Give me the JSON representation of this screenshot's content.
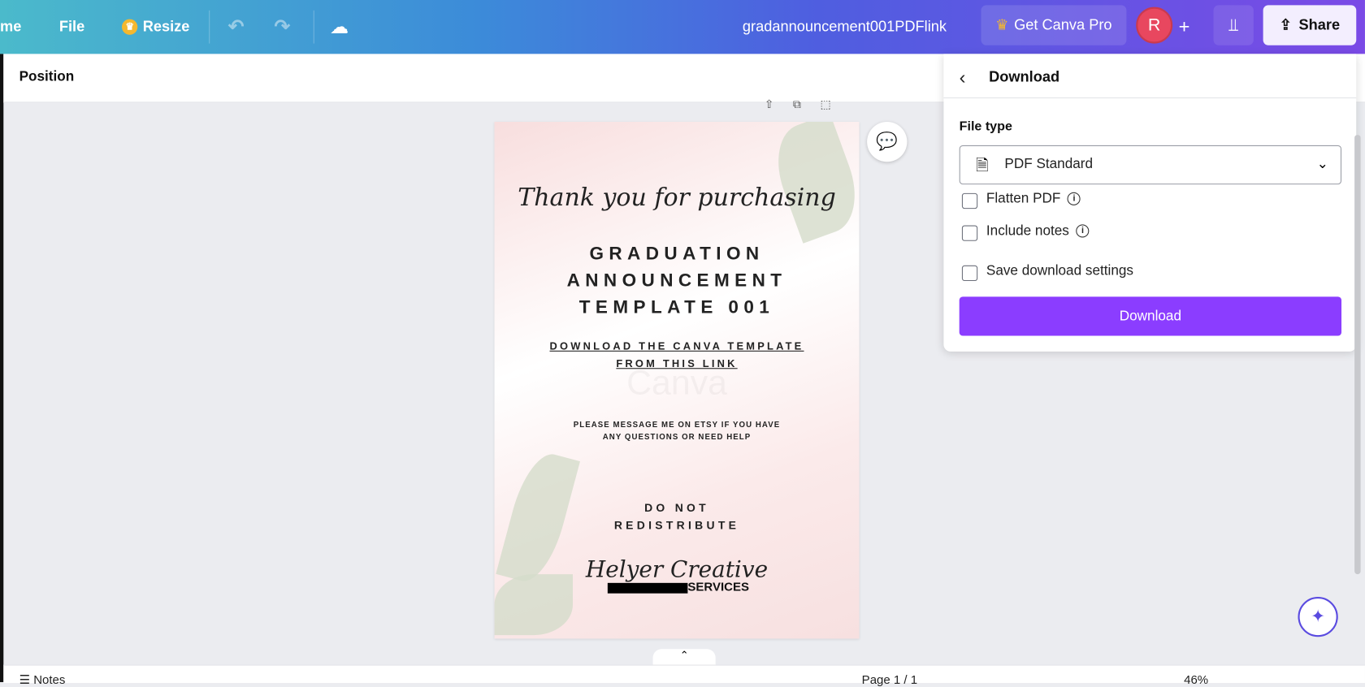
{
  "topbar": {
    "home_label": "me",
    "file_label": "File",
    "resize_label": "Resize",
    "doc_title": "gradannouncement001PDFlink",
    "pro_label": "Get Canva Pro",
    "avatar_initial": "R",
    "add_label": "+",
    "share_label": "Share"
  },
  "toolbar": {
    "position_label": "Position"
  },
  "poster": {
    "script_line": "Thank you for purchasing",
    "title_lines": [
      "GRADUATION",
      "ANNOUNCEMENT",
      "TEMPLATE 001"
    ],
    "link_lines": [
      "DOWNLOAD THE CANVA TEMPLATE",
      "FROM THIS LINK"
    ],
    "message_lines": [
      "PLEASE MESSAGE ME ON ETSY IF YOU HAVE",
      "ANY QUESTIONS OR NEED HELP"
    ],
    "warning_lines": [
      "DO NOT",
      "REDISTRIBUTE"
    ],
    "brand_script": "Helyer Creative",
    "brand_sub": "SERVICES",
    "watermark": "Canva"
  },
  "download_panel": {
    "title": "Download",
    "file_type_label": "File type",
    "file_type_value": "PDF Standard",
    "options": [
      {
        "label": "Flatten PDF",
        "info": true
      },
      {
        "label": "Include notes",
        "info": true
      },
      {
        "label": "Save download settings",
        "info": false
      }
    ],
    "download_button": "Download"
  },
  "bottombar": {
    "notes_label": "Notes",
    "page_label": "Page 1 / 1",
    "zoom_label": "46%"
  },
  "colors": {
    "accent": "#8b3dff",
    "avatar": "#e8475f"
  }
}
